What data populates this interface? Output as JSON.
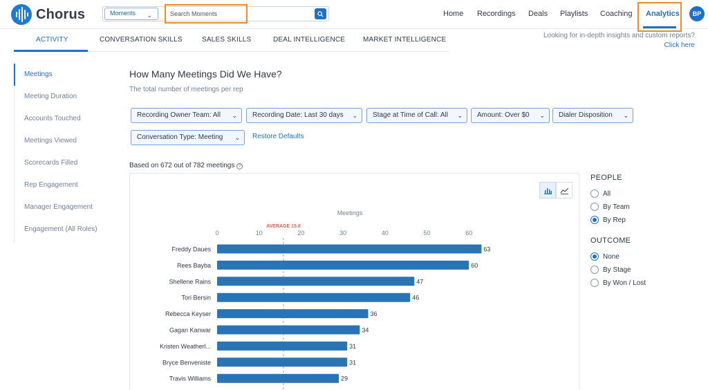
{
  "app": {
    "name": "Chorus",
    "avatar_initials": "BP"
  },
  "search": {
    "type_selected": "Moments",
    "placeholder": "Search Moments"
  },
  "nav": {
    "items": [
      "Home",
      "Recordings",
      "Deals",
      "Playlists",
      "Coaching",
      "Analytics"
    ],
    "active": "Analytics"
  },
  "tabs": {
    "items": [
      "ACTIVITY",
      "CONVERSATION SKILLS",
      "SALES SKILLS",
      "DEAL INTELLIGENCE",
      "MARKET INTELLIGENCE"
    ],
    "active": "ACTIVITY"
  },
  "insights": {
    "text": "Looking for in-depth insights and custom reports?",
    "link": "Click here"
  },
  "sidebar": {
    "items": [
      "Meetings",
      "Meeting Duration",
      "Accounts Touched",
      "Meetings Viewed",
      "Scorecards Filled",
      "Rep Engagement",
      "Manager Engagement",
      "Engagement (All Roles)"
    ],
    "active": "Meetings"
  },
  "page": {
    "title": "How Many Meetings Did We Have?",
    "subtitle": "The total number of meetings per rep",
    "based_on": "Based on 672 out of 782 meetings"
  },
  "filters": [
    {
      "label": "Recording Owner Team:",
      "value": "All"
    },
    {
      "label": "Recording Date:",
      "value": "Last 30 days"
    },
    {
      "label": "Stage at Time of Call:",
      "value": "All"
    },
    {
      "label": "Amount:",
      "value": "Over $0"
    },
    {
      "label": "Dialer Disposition",
      "value": ""
    },
    {
      "label": "Conversation Type:",
      "value": "Meeting"
    }
  ],
  "restore_label": "Restore Defaults",
  "panel": {
    "people_title": "PEOPLE",
    "people_options": [
      "All",
      "By Team",
      "By Rep"
    ],
    "people_selected": "By Rep",
    "outcome_title": "OUTCOME",
    "outcome_options": [
      "None",
      "By Stage",
      "By Won / Lost"
    ],
    "outcome_selected": "None"
  },
  "colors": {
    "accent": "#1f6fc5",
    "bar": "#2a74b5",
    "average": "#e06050",
    "highlight": "#f08a24"
  },
  "chart_data": {
    "type": "bar",
    "orientation": "horizontal",
    "xlabel": "Meetings",
    "xticks": [
      0,
      10,
      20,
      30,
      40,
      50,
      60
    ],
    "xlim": [
      0,
      66
    ],
    "average_label": "AVERAGE 15.8",
    "average": 15.8,
    "categories": [
      "Freddy Daues",
      "Rees Bayba",
      "Shellene Rains",
      "Tori Bersin",
      "Rebecca Keyser",
      "Gagan Kanwar",
      "Kristen Weatherl...",
      "Bryce Benveniste",
      "Travis Williams"
    ],
    "values": [
      63,
      60,
      47,
      46,
      36,
      34,
      31,
      31,
      29
    ]
  }
}
